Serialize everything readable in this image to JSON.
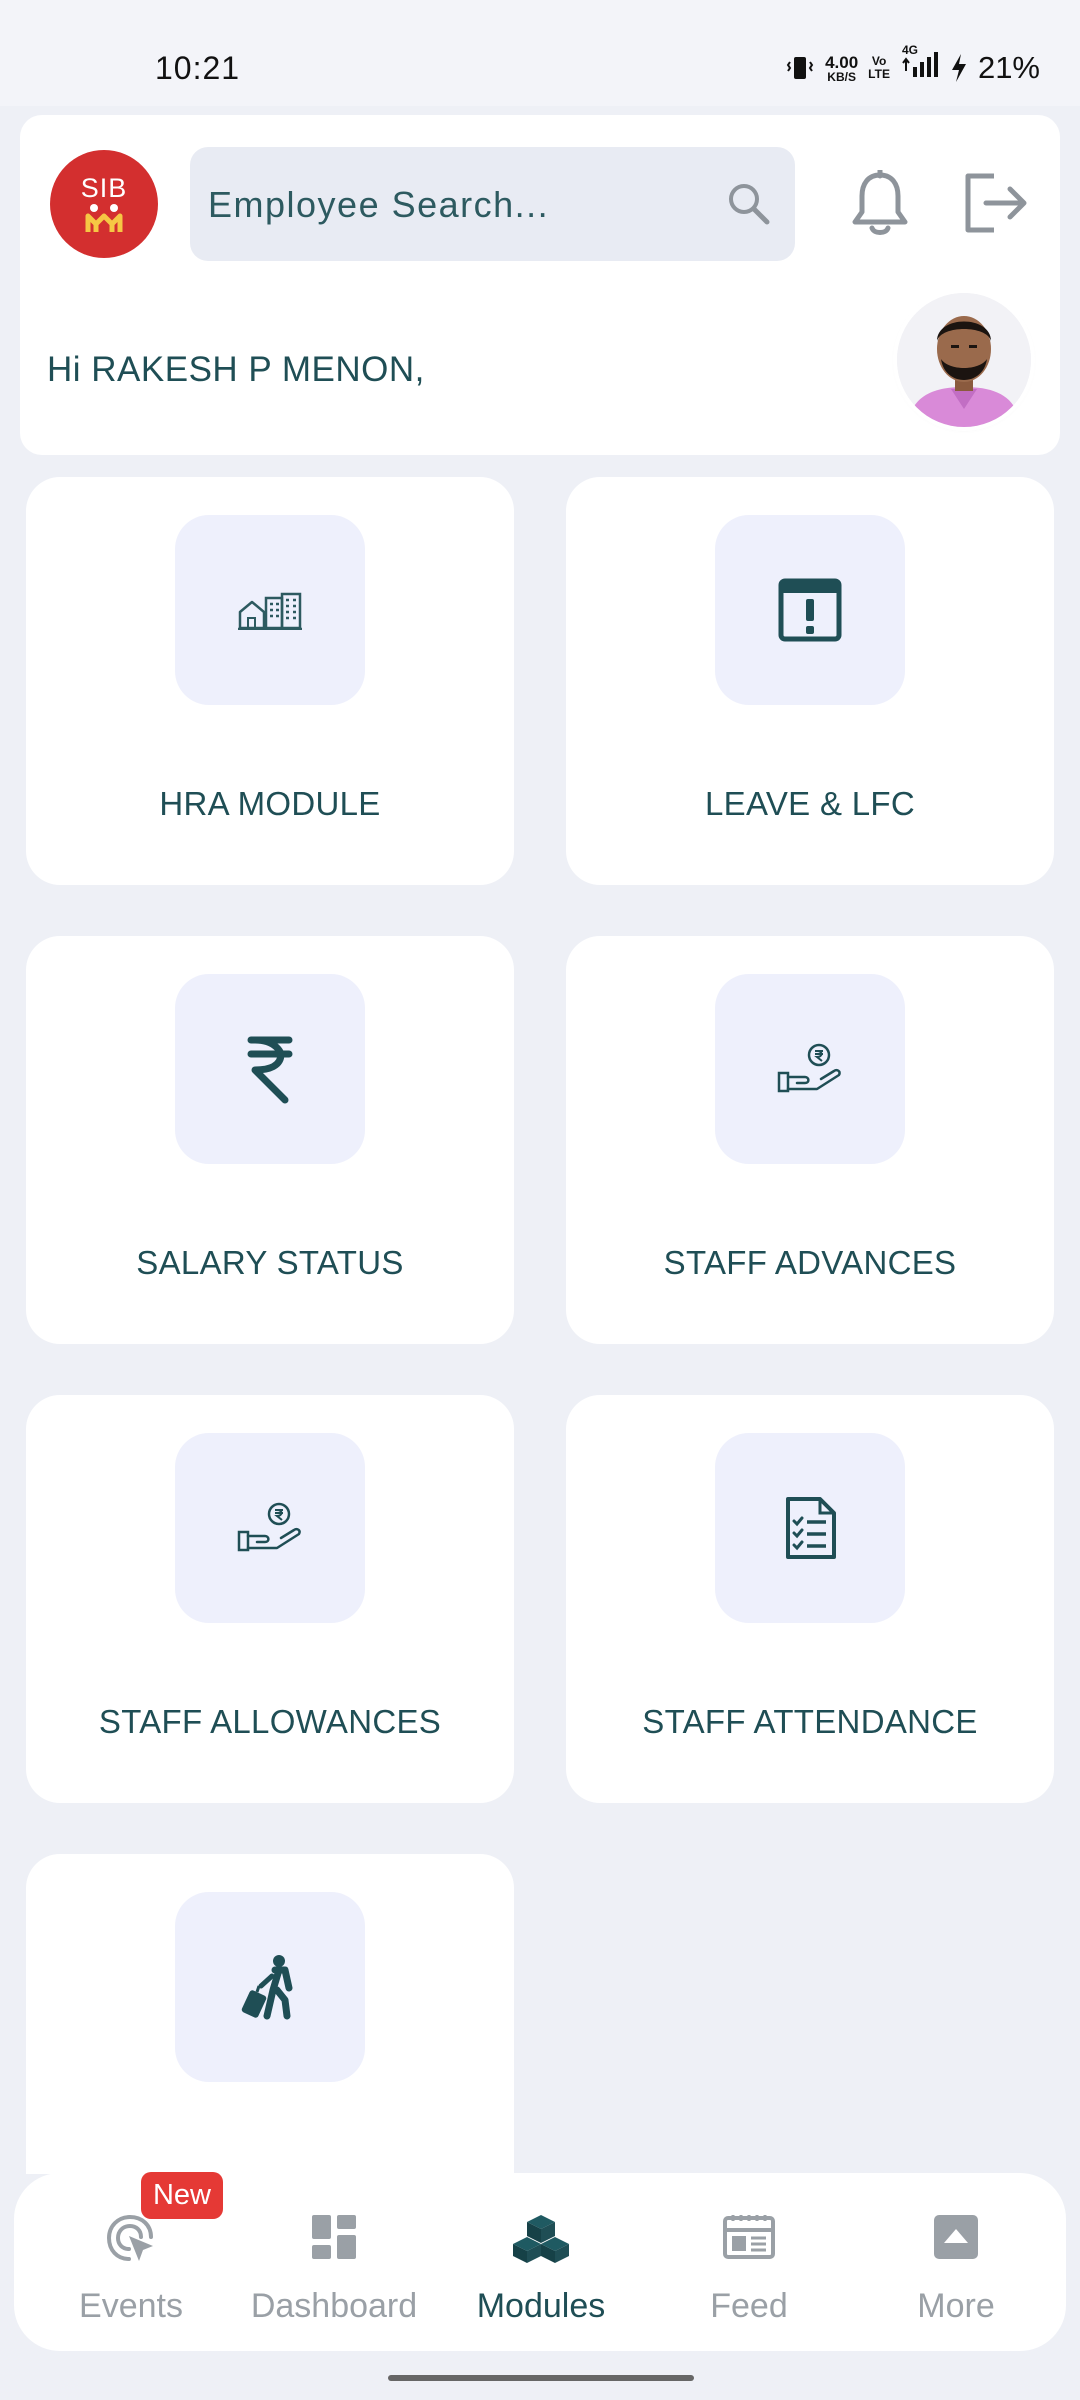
{
  "status_bar": {
    "time": "10:21",
    "net_speed_value": "4.00",
    "net_speed_unit": "KB/S",
    "volte_top": "Vo",
    "volte_bottom": "LTE",
    "network": "4G",
    "battery": "21%"
  },
  "header": {
    "logo_text": "SIB",
    "search_placeholder": "Employee Search...",
    "greeting": "Hi RAKESH P MENON,"
  },
  "modules": [
    {
      "label": "HRA MODULE",
      "icon": "buildings-icon"
    },
    {
      "label": "LEAVE & LFC",
      "icon": "calendar-alert-icon"
    },
    {
      "label": "SALARY STATUS",
      "icon": "rupee-icon"
    },
    {
      "label": "STAFF ADVANCES",
      "icon": "hand-coin-icon"
    },
    {
      "label": "STAFF ALLOWANCES",
      "icon": "hand-coin-icon"
    },
    {
      "label": "STAFF ATTENDANCE",
      "icon": "checklist-icon"
    },
    {
      "label": "",
      "icon": "traveller-icon"
    }
  ],
  "bottom_nav": {
    "badge": "New",
    "items": [
      {
        "label": "Events",
        "icon": "events-icon"
      },
      {
        "label": "Dashboard",
        "icon": "dashboard-icon"
      },
      {
        "label": "Modules",
        "icon": "modules-icon",
        "active": true
      },
      {
        "label": "Feed",
        "icon": "feed-icon"
      },
      {
        "label": "More",
        "icon": "more-icon"
      }
    ]
  },
  "colors": {
    "accent": "#1f4e55",
    "logo_red": "#d32f2f",
    "badge_red": "#e53935",
    "icon_box": "#eef0fc",
    "page_bg": "#eef0f6"
  }
}
